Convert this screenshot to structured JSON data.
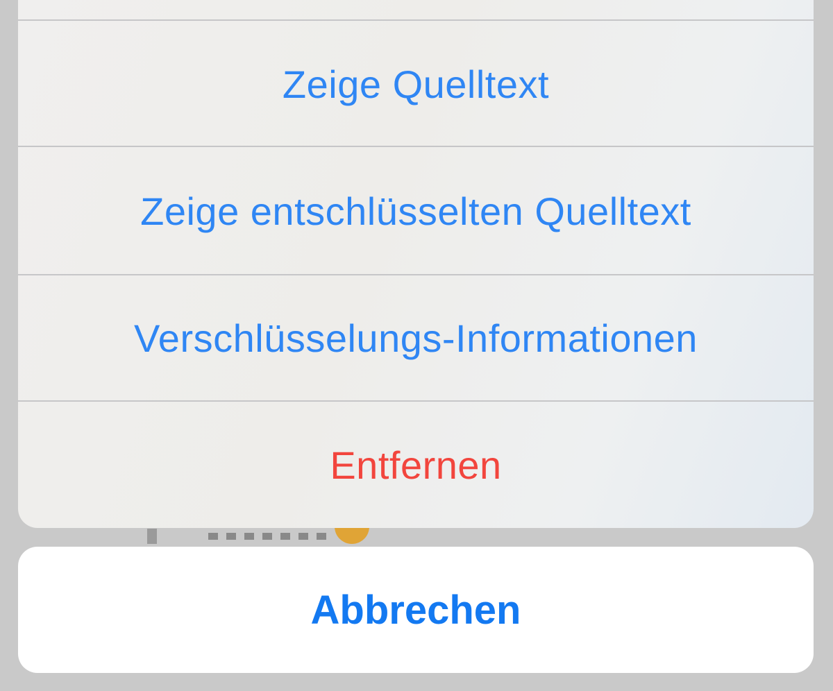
{
  "action_sheet": {
    "actions": [
      {
        "label": "Zeige Quelltext",
        "style": "default"
      },
      {
        "label": "Zeige entschlüsselten Quelltext",
        "style": "default"
      },
      {
        "label": "Verschlüsselungs-Informationen",
        "style": "default"
      },
      {
        "label": "Entfernen",
        "style": "destructive"
      }
    ],
    "cancel_label": "Abbrechen"
  },
  "colors": {
    "action_text": "#2f86f4",
    "destructive_text": "#f2453d",
    "cancel_text": "#1379f1",
    "dim_background": "#c9c9c9"
  }
}
